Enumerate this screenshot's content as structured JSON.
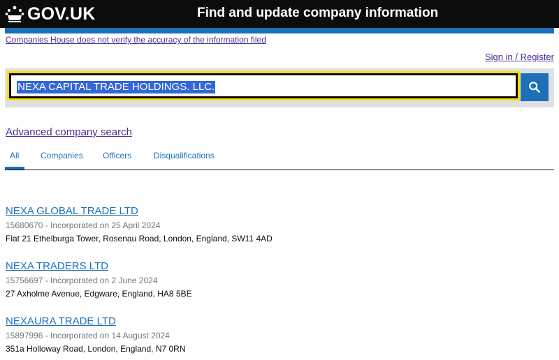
{
  "header": {
    "logo_text": "GOV.UK",
    "service_name": "Find and update company information"
  },
  "disclaimer": "Companies House does not verify the accuracy of the information filed",
  "signin": "Sign in / Register",
  "search": {
    "value": "NEXA CAPITAL TRADE HOLDINGS. LLC.",
    "button_icon": "search-icon"
  },
  "advanced_search": "Advanced company search",
  "tabs": [
    "All",
    "Companies",
    "Officers",
    "Disqualifications"
  ],
  "results": [
    {
      "name": "NEXA GLOBAL TRADE LTD",
      "meta": "15680670 - Incorporated on 25 April 2024",
      "address": "Flat 21 Ethelburga Tower, Rosenau Road, London, England, SW11 4AD"
    },
    {
      "name": "NEXA TRADERS LTD",
      "meta": "15756697 - Incorporated on 2 June 2024",
      "address": "27 Axholme Avenue, Edgware, England, HA8 5BE"
    },
    {
      "name": "NEXAURA TRADE LTD",
      "meta": "15897996 - Incorporated on 14 August 2024",
      "address": "351a Holloway Road, London, England, N7 0RN"
    }
  ],
  "colors": {
    "header_bg": "#0b0c0c",
    "accent_blue": "#1d70b8",
    "focus_yellow": "#ffdd00",
    "visited_link": "#4c2c92"
  }
}
